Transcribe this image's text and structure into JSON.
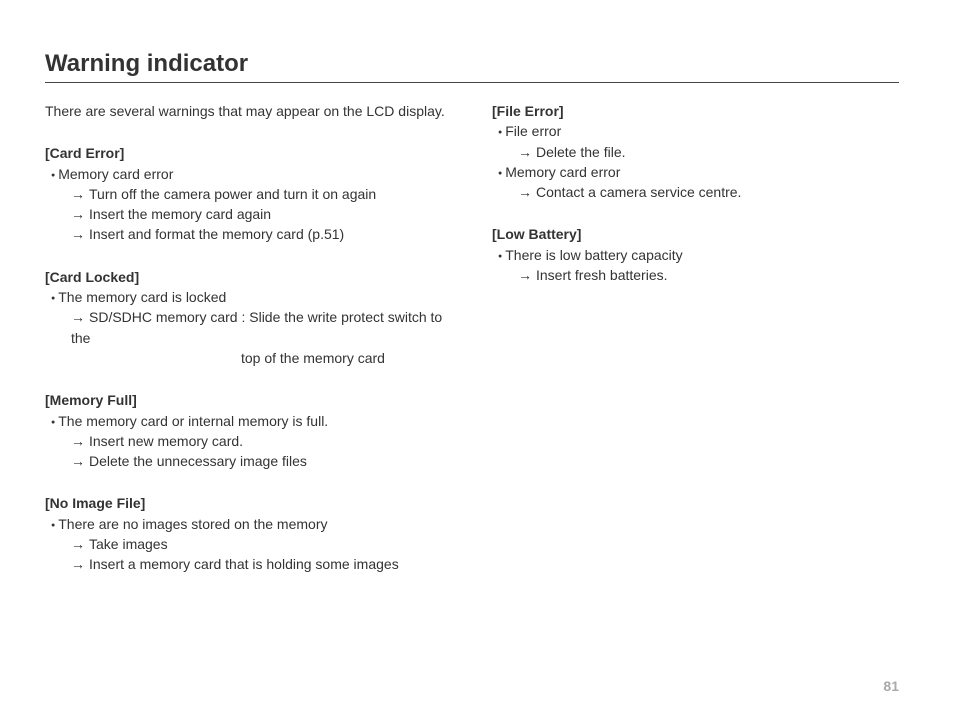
{
  "title": "Warning indicator",
  "intro": "There are several warnings that may appear on the LCD display.",
  "left": {
    "s1": {
      "heading": "[Card Error]",
      "b1": "Memory card error",
      "a1": "Turn off the camera power and turn it on again",
      "a2": "Insert the memory card again",
      "a3": "Insert and format the memory card (p.51)"
    },
    "s2": {
      "heading": "[Card Locked]",
      "b1": "The memory card is locked",
      "a1": "SD/SDHC memory card : Slide the write protect switch to the",
      "a1b": "top of the memory card"
    },
    "s3": {
      "heading": "[Memory Full]",
      "b1": "The memory card or internal memory is full.",
      "a1": "Insert new memory card.",
      "a2": "Delete the unnecessary image files"
    },
    "s4": {
      "heading": "[No Image File]",
      "b1": "There are no images stored on the memory",
      "a1": "Take images",
      "a2": "Insert a memory card that is holding some images"
    }
  },
  "right": {
    "s1": {
      "heading": "[File Error]",
      "b1": "File error",
      "a1": "Delete the file.",
      "b2": "Memory card error",
      "a2": "Contact a camera service centre."
    },
    "s2": {
      "heading": "[Low Battery]",
      "b1": "There is low battery capacity",
      "a1": "Insert fresh batteries."
    }
  },
  "page_number": "81"
}
